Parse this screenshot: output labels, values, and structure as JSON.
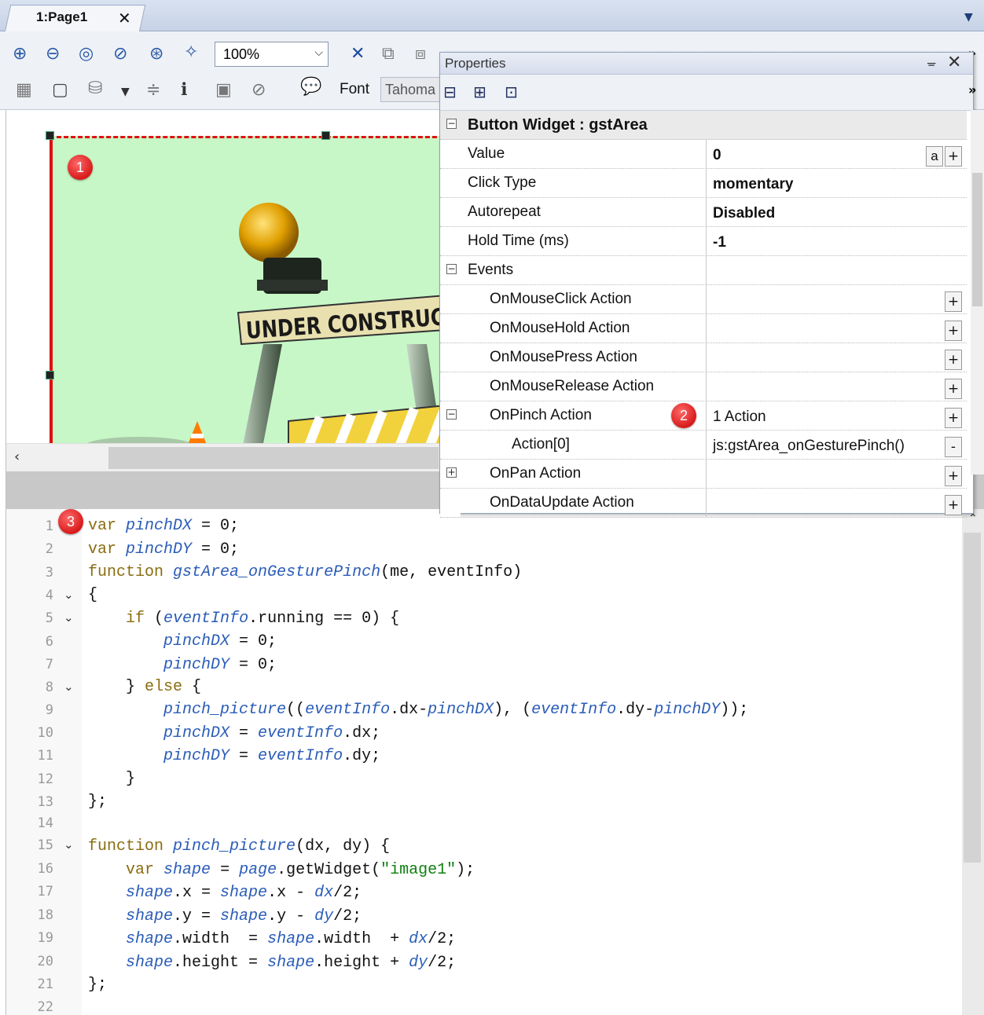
{
  "tab": {
    "label": "1:Page1",
    "close": "✕"
  },
  "toolbar": {
    "zoom_value": "100%",
    "font_label": "Font",
    "font_value": "Tahoma"
  },
  "canvas": {
    "badge": "1",
    "sign_text": "UNDER CONSTRUCTION"
  },
  "properties": {
    "title": "Properties",
    "header": "Button Widget : gstArea",
    "rows": [
      {
        "name": "Value",
        "value": "0"
      },
      {
        "name": "Click Type",
        "value": "momentary"
      },
      {
        "name": "Autorepeat",
        "value": "Disabled"
      },
      {
        "name": "Hold Time (ms)",
        "value": "-1"
      },
      {
        "name": "Events",
        "value": ""
      },
      {
        "name": "OnMouseClick Action",
        "value": ""
      },
      {
        "name": "OnMouseHold Action",
        "value": ""
      },
      {
        "name": "OnMousePress Action",
        "value": ""
      },
      {
        "name": "OnMouseRelease Action",
        "value": ""
      },
      {
        "name": "OnPinch Action",
        "value": "1 Action"
      },
      {
        "name": "Action[0]",
        "value": "js:gstArea_onGesturePinch()"
      },
      {
        "name": "OnPan Action",
        "value": ""
      },
      {
        "name": "OnDataUpdate Action",
        "value": ""
      }
    ],
    "badge": "2",
    "a_button": "a"
  },
  "editor": {
    "badge": "3",
    "line_numbers": [
      "1",
      "2",
      "3",
      "4",
      "5",
      "6",
      "7",
      "8",
      "9",
      "10",
      "11",
      "12",
      "13",
      "14",
      "15",
      "16",
      "17",
      "18",
      "19",
      "20",
      "21",
      "22"
    ]
  }
}
